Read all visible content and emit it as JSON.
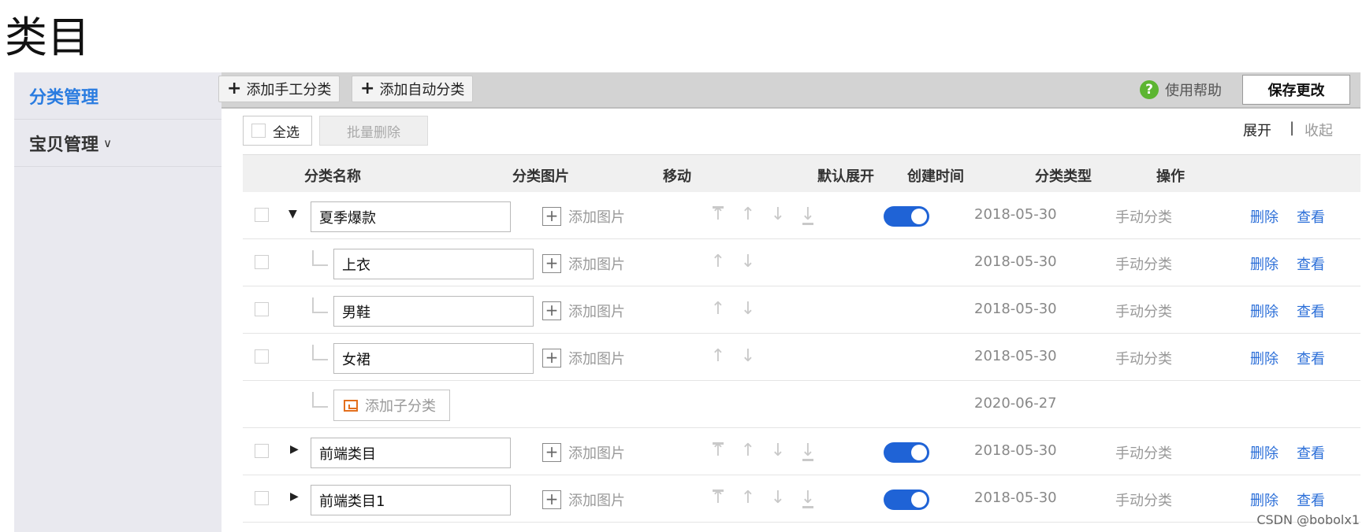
{
  "page": {
    "title": "类目"
  },
  "sidebar": {
    "items": [
      {
        "label": "分类管理",
        "active": true
      },
      {
        "label": "宝贝管理",
        "icon": "chevron-down-icon"
      }
    ]
  },
  "toolbar": {
    "add_manual_label": "添加手工分类",
    "add_auto_label": "添加自动分类",
    "help_label": "使用帮助",
    "save_label": "保存更改"
  },
  "actions": {
    "select_all_label": "全选",
    "batch_delete_label": "批量删除",
    "expand_label": "展开",
    "separator": "|",
    "collapse_label": "收起"
  },
  "table": {
    "columns": [
      "分类名称",
      "分类图片",
      "移动",
      "默认展开",
      "创建时间",
      "分类类型",
      "操作"
    ],
    "add_image_label": "添加图片",
    "delete_label": "删除",
    "view_label": "查看",
    "add_sub_label": "添加子分类",
    "rows": [
      {
        "name": "夏季爆款",
        "level": 0,
        "expanded": true,
        "default_expand": true,
        "date": "2018-05-30",
        "type": "手动分类"
      },
      {
        "name": "上衣",
        "level": 1,
        "date": "2018-05-30",
        "type": "手动分类"
      },
      {
        "name": "男鞋",
        "level": 1,
        "date": "2018-05-30",
        "type": "手动分类"
      },
      {
        "name": "女裙",
        "level": 1,
        "date": "2018-05-30",
        "type": "手动分类"
      },
      {
        "add_sub": true,
        "date": "2020-06-27"
      },
      {
        "name": "前端类目",
        "level": 0,
        "expanded": false,
        "default_expand": true,
        "date": "2018-05-30",
        "type": "手动分类"
      },
      {
        "name": "前端类目1",
        "level": 0,
        "expanded": false,
        "default_expand": true,
        "date": "2018-05-30",
        "type": "手动分类"
      }
    ]
  },
  "watermark": "CSDN @bobolx1",
  "colors": {
    "accent": "#2a7ce0",
    "link": "#2c6fd8",
    "toggle_on": "#1f63d6",
    "help_icon": "#5cb531"
  }
}
